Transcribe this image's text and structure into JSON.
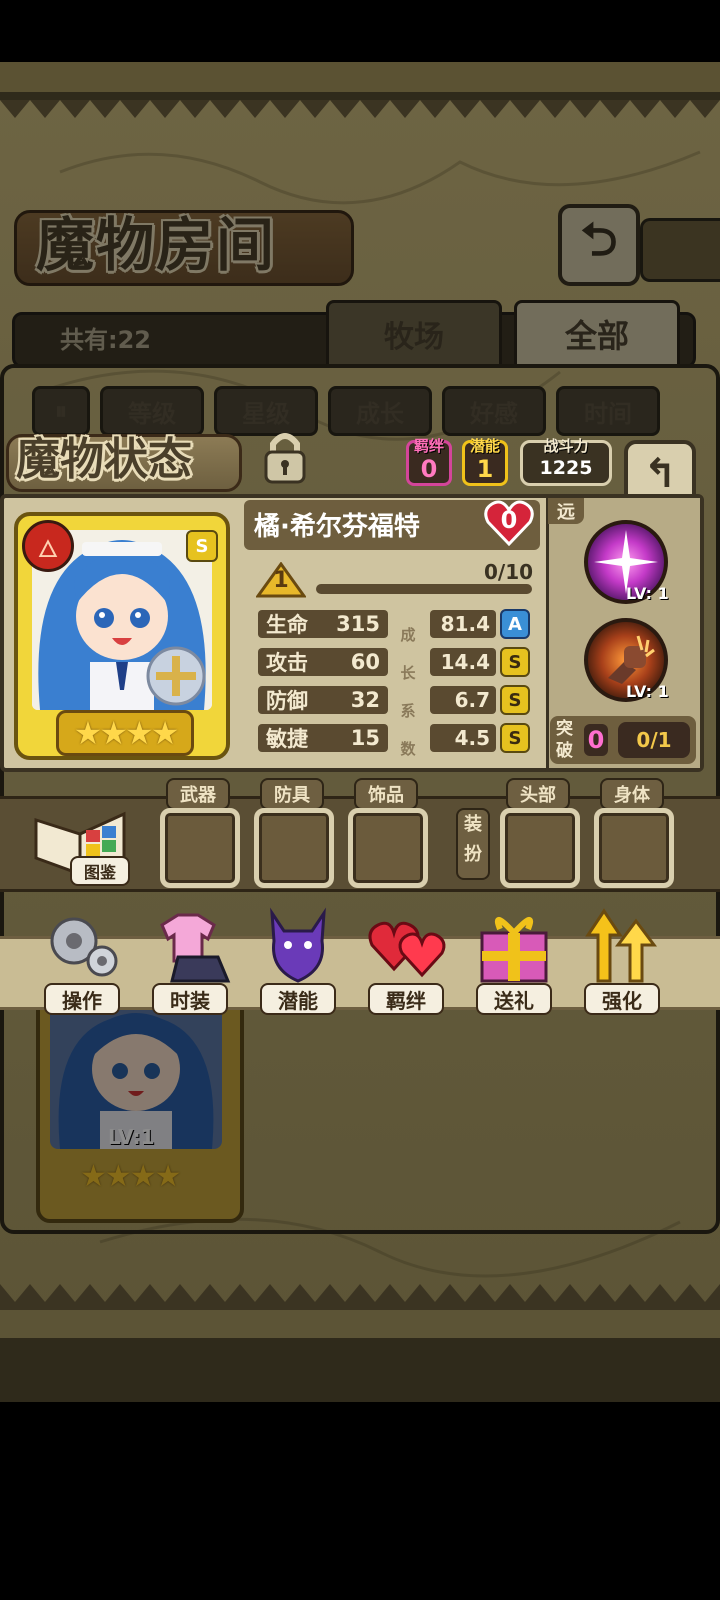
{
  "room": {
    "title": "魔物房间",
    "total_label": "共有:22",
    "tabs": [
      "牧场",
      "全部"
    ],
    "sort_buttons": [
      "等级",
      "星级",
      "成长",
      "好感",
      "时间"
    ]
  },
  "status": {
    "title": "魔物状态",
    "bond_label": "羁绊",
    "bond_value": "0",
    "potential_label": "潜能",
    "potential_value": "1",
    "power_label": "战斗力",
    "power_value": "1225"
  },
  "monster": {
    "name": "橘·希尔芬福特",
    "affection": "0",
    "grade": "S",
    "stars": 4,
    "level_badge": "1",
    "exp": "0/10",
    "exp_fraction": 0,
    "range_label": "远",
    "growth_side_label": [
      "成",
      "长",
      "系",
      "数"
    ],
    "stats": [
      {
        "name": "生命",
        "value": "315",
        "growth": "81.4",
        "grade": "A"
      },
      {
        "name": "攻击",
        "value": "60",
        "growth": "14.4",
        "grade": "S"
      },
      {
        "name": "防御",
        "value": "32",
        "growth": "6.7",
        "grade": "S"
      },
      {
        "name": "敏捷",
        "value": "15",
        "growth": "4.5",
        "grade": "S"
      }
    ],
    "skills": [
      {
        "level": "LV: 1",
        "icon": "magic-sparkle-icon"
      },
      {
        "level": "LV: 1",
        "icon": "fist-strike-icon"
      }
    ],
    "breakthrough_label": [
      "突",
      "破"
    ],
    "breakthrough_value": "0",
    "breakthrough_progress": "0/1"
  },
  "equipment": {
    "book_label": "图鉴",
    "slots_left": [
      "武器",
      "防具",
      "饰品"
    ],
    "dress_label": [
      "装",
      "扮"
    ],
    "slots_right": [
      "头部",
      "身体"
    ]
  },
  "actions": [
    {
      "label": "操作",
      "icon": "gear-icon"
    },
    {
      "label": "时装",
      "icon": "outfit-icon"
    },
    {
      "label": "潜能",
      "icon": "demon-icon"
    },
    {
      "label": "羁绊",
      "icon": "hearts-icon"
    },
    {
      "label": "送礼",
      "icon": "gift-icon"
    },
    {
      "label": "强化",
      "icon": "upgrade-arrows-icon"
    }
  ],
  "background_card": {
    "level": "LV:1",
    "stars": 4
  },
  "colors": {
    "gold": "#f2c02a",
    "bond_pink": "#d4459a",
    "potential_yellow": "#f0c21a",
    "grade_s": "#e6c21f",
    "grade_a": "#3a8fd6"
  }
}
